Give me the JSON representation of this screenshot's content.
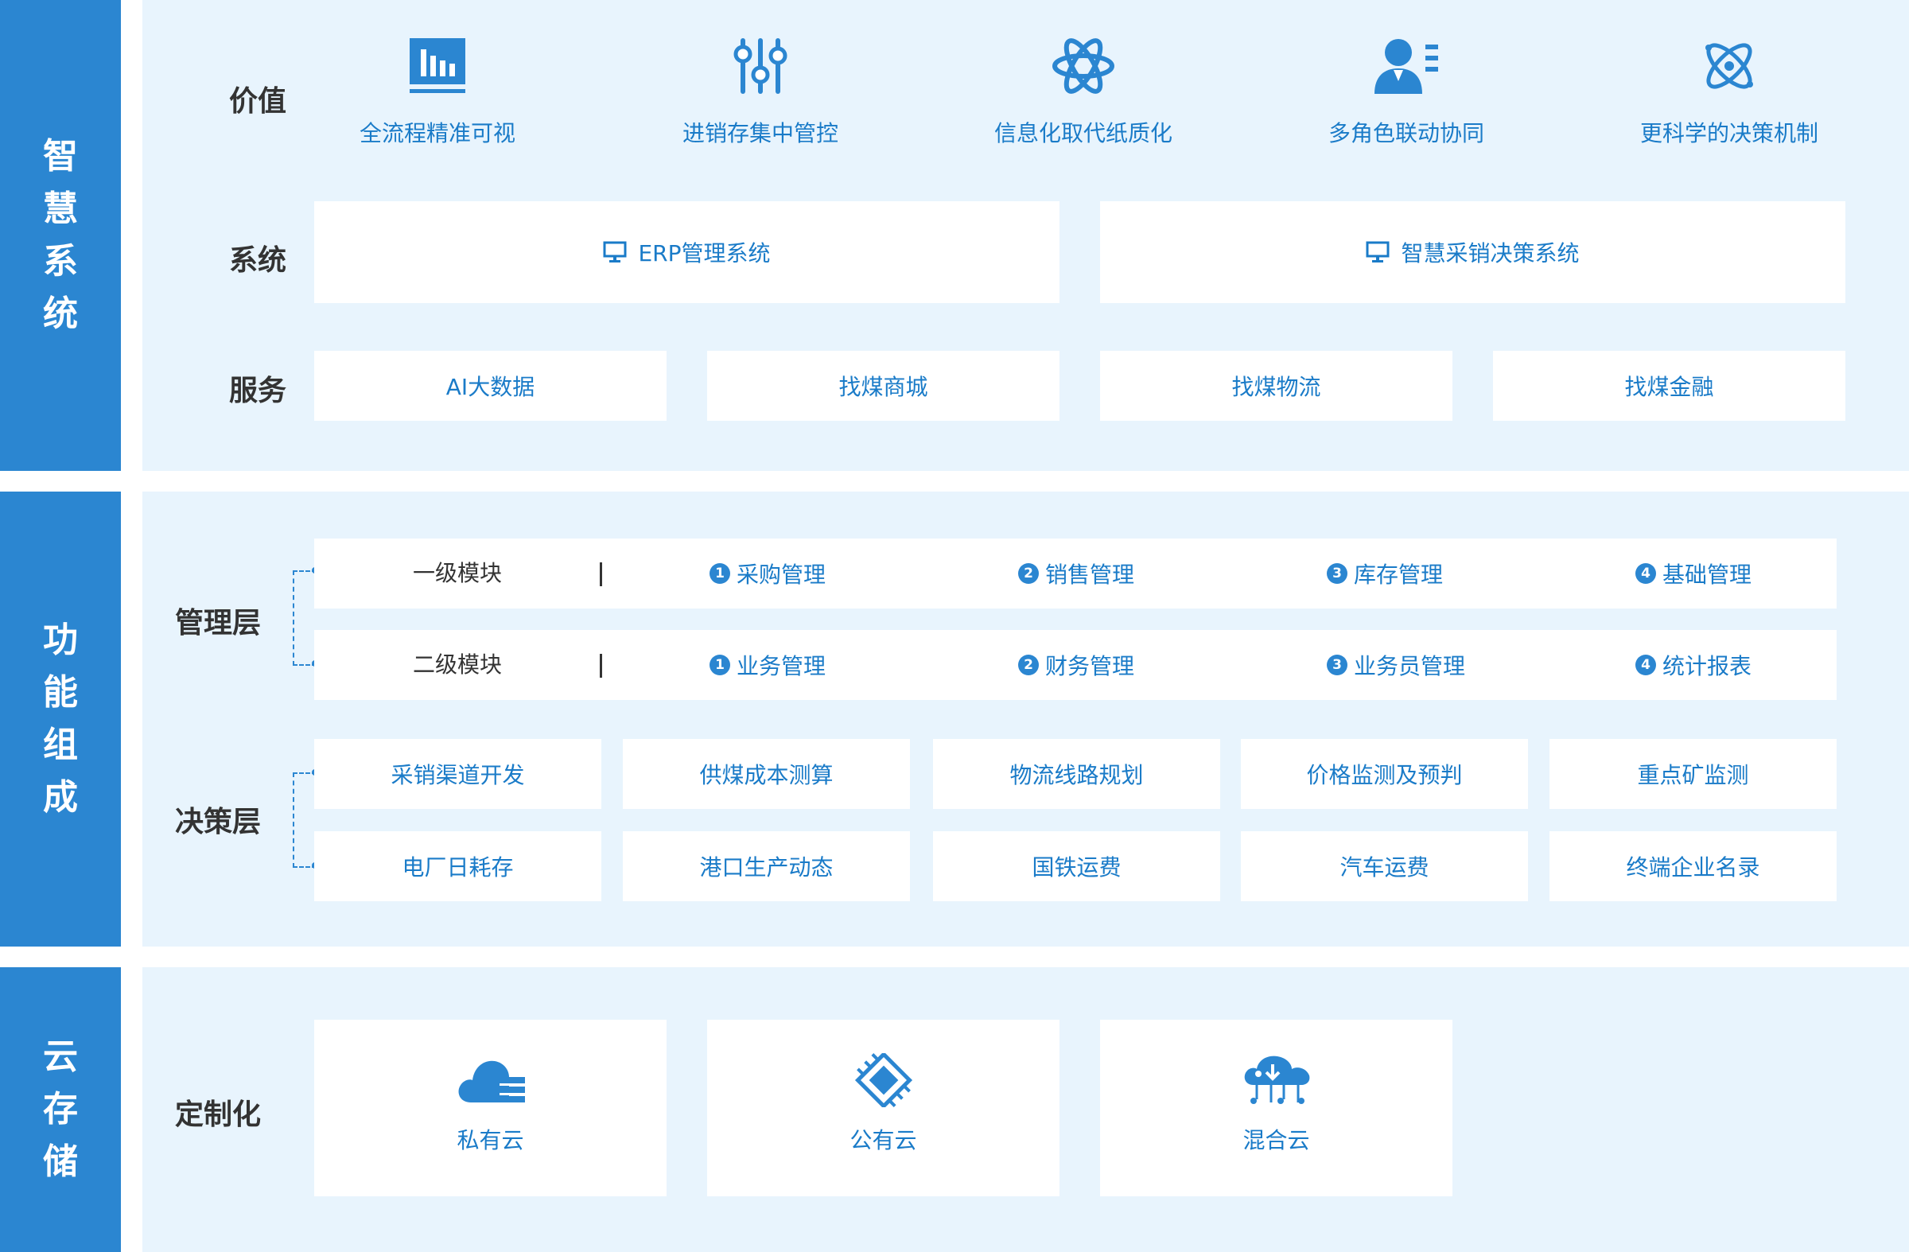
{
  "sections": {
    "smart_system": "智慧系统",
    "function_composition": "功能组成",
    "cloud_storage": "云存储"
  },
  "labels": {
    "value": "价值",
    "system": "系统",
    "service": "服务",
    "management_layer": "管理层",
    "decision_layer": "决策层",
    "customization": "定制化"
  },
  "values": [
    {
      "label": "全流程精准可视",
      "icon": "bar-chart-icon"
    },
    {
      "label": "进销存集中管控",
      "icon": "sliders-icon"
    },
    {
      "label": "信息化取代纸质化",
      "icon": "orbit-icon"
    },
    {
      "label": "多角色联动协同",
      "icon": "user-list-icon"
    },
    {
      "label": "更科学的决策机制",
      "icon": "atom-icon"
    }
  ],
  "systems": [
    {
      "label": "ERP管理系统",
      "icon": "monitor-icon"
    },
    {
      "label": "智慧采销决策系统",
      "icon": "monitor-icon"
    }
  ],
  "services": [
    "AI大数据",
    "找煤商城",
    "找煤物流",
    "找煤金融"
  ],
  "management": {
    "level1": {
      "title": "一级模块",
      "items": [
        {
          "num": "1",
          "label": "采购管理"
        },
        {
          "num": "2",
          "label": "销售管理"
        },
        {
          "num": "3",
          "label": "库存管理"
        },
        {
          "num": "4",
          "label": "基础管理"
        }
      ]
    },
    "level2": {
      "title": "二级模块",
      "items": [
        {
          "num": "1",
          "label": "业务管理"
        },
        {
          "num": "2",
          "label": "财务管理"
        },
        {
          "num": "3",
          "label": "业务员管理"
        },
        {
          "num": "4",
          "label": "统计报表"
        }
      ]
    }
  },
  "decision": {
    "row1": [
      "采销渠道开发",
      "供煤成本测算",
      "物流线路规划",
      "价格监测及预判",
      "重点矿监测"
    ],
    "row2": [
      "电厂日耗存",
      "港口生产动态",
      "国铁运费",
      "汽车运费",
      "终端企业名录"
    ]
  },
  "clouds": [
    {
      "label": "私有云",
      "icon": "private-cloud-icon"
    },
    {
      "label": "公有云",
      "icon": "chip-icon"
    },
    {
      "label": "混合云",
      "icon": "hybrid-cloud-icon"
    }
  ],
  "colors": {
    "primary": "#2b86d1",
    "panel_bg": "#e8f4fd",
    "text_blue": "#1a7bc8",
    "text_dark": "#333333"
  }
}
